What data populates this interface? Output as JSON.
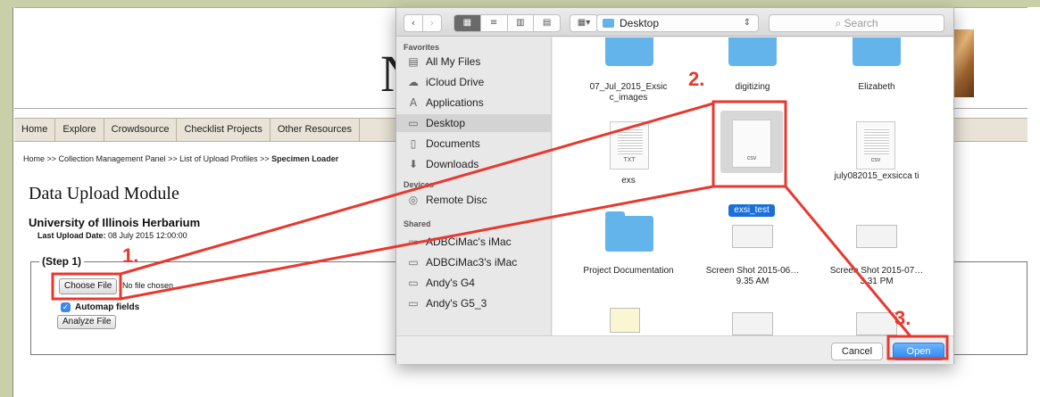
{
  "page": {
    "banner_letter": "N",
    "nav": [
      "Home",
      "Explore",
      "Crowdsource",
      "Checklist Projects",
      "Other Resources"
    ],
    "breadcrumb": {
      "trail": "Home >> Collection Management Panel >> List of Upload Profiles >> ",
      "current": "Specimen Loader"
    },
    "title": "Data Upload Module",
    "institution": "University of Illinois Herbarium",
    "last_upload_label": "Last Upload Date:",
    "last_upload_value": "08 July 2015 12:00:00",
    "step_label": "(Step 1)",
    "choose_file": "Choose File",
    "no_file": "No file chosen",
    "automap_label": "Automap fields",
    "automap_checked": true,
    "analyze_button": "Analyze File"
  },
  "dialog": {
    "location": "Desktop",
    "search_placeholder": "Search",
    "sidebar": {
      "favorites_head": "Favorites",
      "favorites": [
        "All My Files",
        "iCloud Drive",
        "Applications",
        "Desktop",
        "Documents",
        "Downloads"
      ],
      "devices_head": "Devices",
      "devices": [
        "Remote Disc"
      ],
      "shared_head": "Shared",
      "shared": [
        "ADBCiMac's iMac",
        "ADBCiMac3's iMac",
        "Andy's G4",
        "Andy's G5_3"
      ]
    },
    "files": {
      "f1": "07_Jul_2015_Exsic c_images",
      "f2": "digitizing",
      "f3": "Elizabeth",
      "f4": "exs",
      "f4_type": "TXT",
      "f5": "exsi_test",
      "f5_type": "csv",
      "f6": "july082015_exsicca ti",
      "f6_type": "csv",
      "f7": "Project Documentation",
      "f8": "Screen Shot 2015-06…9.35 AM",
      "f9": "Screen Shot 2015-07…3.31 PM"
    },
    "cancel": "Cancel",
    "open": "Open"
  },
  "annotations": {
    "color": "#e8382e",
    "steps": [
      "1.",
      "2.",
      "3."
    ]
  }
}
